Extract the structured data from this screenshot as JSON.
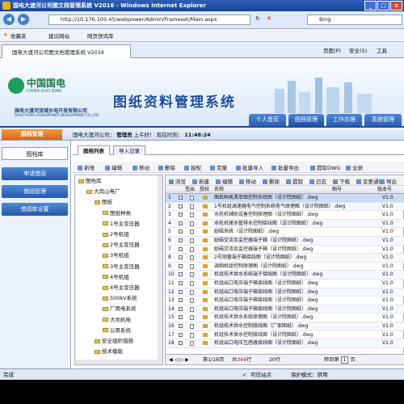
{
  "window": {
    "title": "国电大渡河公司图文档管理系统 V2016 - Windows Internet Explorer"
  },
  "address": {
    "url": "http://10.176.105.45/webpower/Admin/Frameset/Main.aspx",
    "search_placeholder": "Bing"
  },
  "favorites": {
    "label": "收藏夹",
    "item1": "建议网站",
    "item2": "网页快讯库"
  },
  "ie_tab": {
    "title": "国电大渡河公司图文档管理系统 V2016",
    "tools": [
      "页面(P)",
      "安全(S)",
      "工具"
    ]
  },
  "banner": {
    "logo_cn": "中国国电",
    "logo_en": "CHINA GUO DIAN",
    "company_cn": "国电大渡河流域水电开发有限公司",
    "company_en": "DADU RIVER HYDROPOWER DEVELOPMENT CO.,LTD.",
    "system_title": "图纸资料管理系统",
    "nav": [
      "个人首页",
      "图档管理",
      "工作办理",
      "系统管理"
    ]
  },
  "userbar": {
    "section": "图档管理",
    "greeting": "国电大渡河公司：",
    "role": "管理员",
    "period": "上午好！",
    "time_label": "现在时刻：",
    "time": "11:48:24"
  },
  "sidebar": {
    "items": [
      "图档库",
      "申请借阅",
      "借阅管理",
      "借阅库设置"
    ]
  },
  "main": {
    "tabs": [
      "图档列表",
      "导入记录"
    ],
    "toolbar": [
      "新增",
      "编辑",
      "移动",
      "删除",
      "授权",
      "克隆",
      "批量导入",
      "批量导出",
      "提取DWG",
      "全屏"
    ],
    "toolbar2": [
      "浏览",
      "新建",
      "编辑",
      "移动",
      "删除",
      "提取",
      "日志",
      "下载",
      "变更通知",
      "导出"
    ],
    "tree": [
      {
        "label": "图档库",
        "indent": 0
      },
      {
        "label": "大岗山电厂",
        "indent": 1
      },
      {
        "label": "图纸",
        "indent": 2
      },
      {
        "label": "图纸种类",
        "indent": 3
      },
      {
        "label": "1号主变压器",
        "indent": 3
      },
      {
        "label": "2号机组",
        "indent": 3
      },
      {
        "label": "2号主变压器",
        "indent": 3
      },
      {
        "label": "3号机组",
        "indent": 3
      },
      {
        "label": "3号主变压器",
        "indent": 3
      },
      {
        "label": "4号机组",
        "indent": 3
      },
      {
        "label": "4号主变压器",
        "indent": 3
      },
      {
        "label": "500kV系统",
        "indent": 3
      },
      {
        "label": "厂用电系统",
        "indent": 3
      },
      {
        "label": "大坝机电",
        "indent": 3
      },
      {
        "label": "公用系统",
        "indent": 3
      },
      {
        "label": "安全组织措施",
        "indent": 2
      },
      {
        "label": "技术模版",
        "indent": 2
      }
    ],
    "columns": [
      "签出",
      "授权",
      "名称",
      "图号",
      "版本号"
    ],
    "rows": [
      {
        "no": "1",
        "name": "图纸种类清单图控制系统图（设计院图纸）.dwg",
        "ver": "V1.0"
      },
      {
        "no": "2",
        "name": "1号机组调速器电气控制系统电气原理图（设计院图纸）.dwg",
        "ver": "V1.0"
      },
      {
        "no": "3",
        "name": "水轮机辅助设备控制原理图（设计院图纸）.dwg",
        "ver": "V1.0"
      },
      {
        "no": "4",
        "name": "水轮机尾水管排水控制接线图（设计院图纸）.dwg",
        "ver": "V1.0"
      },
      {
        "no": "5",
        "name": "励磁系统（设计院图纸）.dwg",
        "ver": "V1.0"
      },
      {
        "no": "6",
        "name": "励磁交流及监控器端子箱（设计院图纸）.dwg",
        "ver": "V1.0"
      },
      {
        "no": "7",
        "name": "励磁交流及监控器端子箱（设计院图纸）.dwg",
        "ver": "V1.0"
      },
      {
        "no": "8",
        "name": "2号测量端子箱接线图（设计院图纸）.dwg",
        "ver": "V1.0"
      },
      {
        "no": "9",
        "name": "调相机组控制原理图（设计院图纸）.dwg",
        "ver": "V1.0"
      },
      {
        "no": "10",
        "name": "机组技术供水系统端子接线图（设计院图纸）.dwg",
        "ver": "V1.0"
      },
      {
        "no": "11",
        "name": "机组出口电压端子箱接线图（设计院图纸）.dwg",
        "ver": "V1.0"
      },
      {
        "no": "12",
        "name": "机组出口电压端子箱接线图（设计院图纸）.dwg",
        "ver": "V1.0"
      },
      {
        "no": "13",
        "name": "机组出口电压端子箱接线图（设计院图纸）.dwg",
        "ver": "V1.0"
      },
      {
        "no": "14",
        "name": "机组出口电压端子箱接线图（设计院图纸）.dwg",
        "ver": "V1.0"
      },
      {
        "no": "15",
        "name": "机组技术供水系统原理图（设计院图纸）.dwg",
        "ver": "V1.0"
      },
      {
        "no": "16",
        "name": "机组技术供水控制接线图（厂家图纸）.dwg",
        "ver": "V1.0"
      },
      {
        "no": "17",
        "name": "机组技术供水控制接线图（设计院图纸）.dwg",
        "ver": "V1.0"
      },
      {
        "no": "18",
        "name": "机组出口电压互感器接线图（设计院图纸）.dwg",
        "ver": "V1.0"
      }
    ],
    "pager": {
      "page_prefix": "第",
      "page": "1/18",
      "page_suffix": "页",
      "total_prefix": "共",
      "total": "349",
      "total_suffix": "行",
      "per_page": "20",
      "per_page_suffix": "行",
      "goto": "转到第",
      "goto_value": "1",
      "goto_suffix": "页"
    }
  },
  "statusbar": {
    "left": "完成",
    "zone": "可信站点",
    "protect": "保护模式：禁用"
  }
}
